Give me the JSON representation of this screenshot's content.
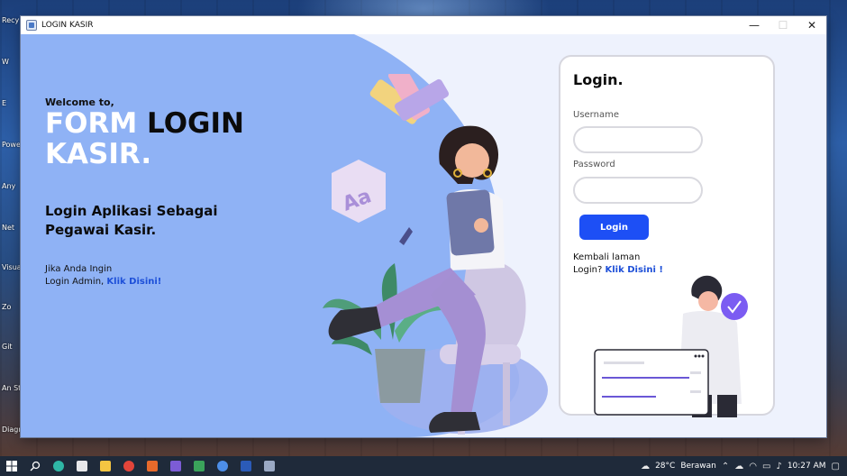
{
  "window": {
    "title": "LOGIN KASIR",
    "minimize_glyph": "—",
    "maximize_glyph": "☐",
    "close_glyph": "✕"
  },
  "left_panel": {
    "welcome": "Welcome to,",
    "title_white": "FORM",
    "title_dark": "LOGIN",
    "title_line2": "KASIR.",
    "subtitle": "Login Aplikasi Sebagai Pegawai Kasir.",
    "admin_line1": "Jika Anda Ingin",
    "admin_line2_prefix": "Login Admin,",
    "admin_link": "Klik Disini!"
  },
  "login_card": {
    "title": "Login.",
    "username_label": "Username",
    "username_value": "",
    "password_label": "Password",
    "password_value": "",
    "login_button": "Login",
    "back_line1": "Kembali laman",
    "back_line2_prefix": "Login?",
    "back_link": "Klik Disini !"
  },
  "desktop_icons": [
    "Recy",
    "W",
    "E",
    "Powe",
    "Any",
    "Net",
    "Visua C",
    "Zo",
    "Git",
    "An St",
    "Diagr"
  ],
  "taskbar": {
    "weather_temp": "28°C",
    "weather_text": "Berawan",
    "time": "10:27 AM"
  },
  "colors": {
    "accent_blue": "#1d4ff5",
    "panel_blue": "#8fb2f5",
    "link_blue": "#1d4fd8"
  }
}
